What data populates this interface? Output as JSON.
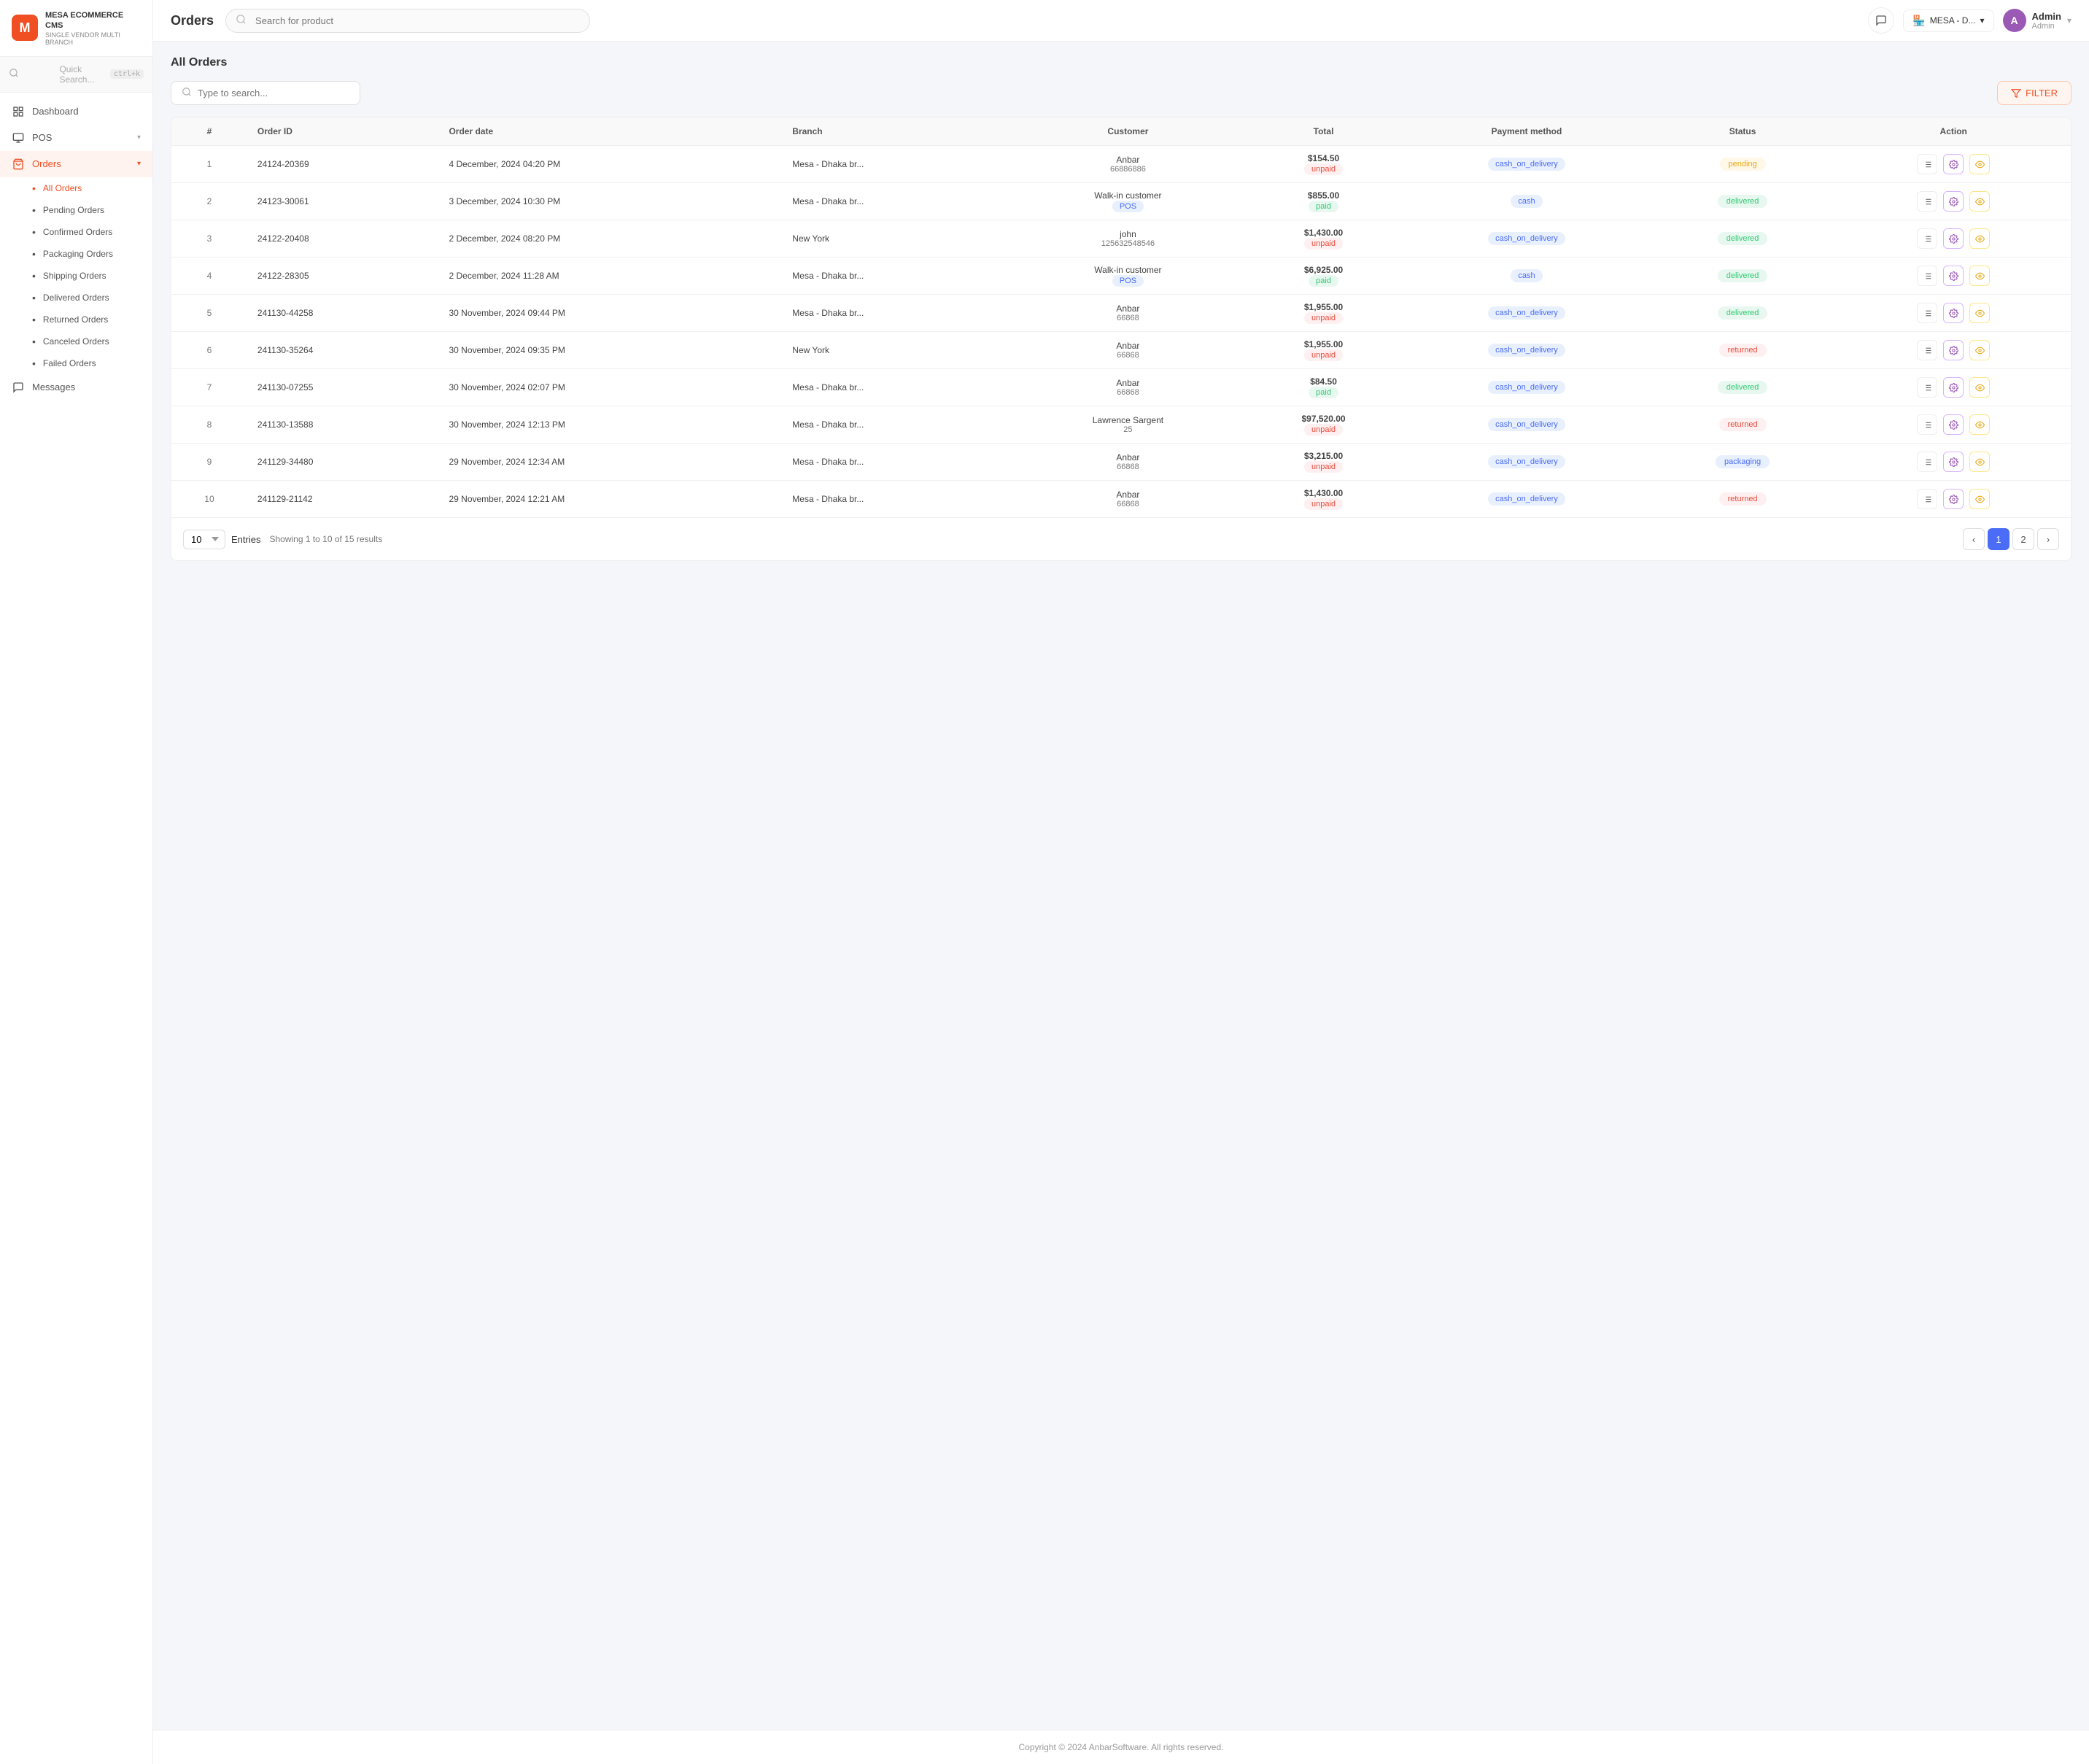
{
  "app": {
    "name": "MESA ECOMMERCE CMS",
    "tagline": "SINGLE VENDOR MULTI BRANCH"
  },
  "sidebar": {
    "search_placeholder": "Quick Search...",
    "search_shortcut": "ctrl+k",
    "nav_items": [
      {
        "id": "dashboard",
        "label": "Dashboard",
        "icon": "dashboard"
      },
      {
        "id": "pos",
        "label": "POS",
        "icon": "pos",
        "has_children": true
      },
      {
        "id": "orders",
        "label": "Orders",
        "icon": "orders",
        "active": true,
        "has_children": true
      }
    ],
    "orders_sub_items": [
      {
        "id": "all-orders",
        "label": "All Orders",
        "active": true
      },
      {
        "id": "pending-orders",
        "label": "Pending Orders"
      },
      {
        "id": "confirmed-orders",
        "label": "Confirmed Orders"
      },
      {
        "id": "packaging-orders",
        "label": "Packaging Orders"
      },
      {
        "id": "shipping-orders",
        "label": "Shipping Orders"
      },
      {
        "id": "delivered-orders",
        "label": "Delivered Orders"
      },
      {
        "id": "returned-orders",
        "label": "Returned Orders"
      },
      {
        "id": "canceled-orders",
        "label": "Canceled Orders"
      },
      {
        "id": "failed-orders",
        "label": "Failed Orders"
      }
    ],
    "extra_items": [
      {
        "id": "messages",
        "label": "Messages",
        "icon": "messages"
      }
    ]
  },
  "topbar": {
    "page_title": "Orders",
    "search_placeholder": "Search for product",
    "branch_name": "MESA - D...",
    "user": {
      "name": "Admin",
      "role": "Admin",
      "avatar_letter": "A"
    }
  },
  "content": {
    "title": "All Orders",
    "filter_placeholder": "Type to search...",
    "filter_btn": "FILTER",
    "table": {
      "columns": [
        "#",
        "Order ID",
        "Order date",
        "Branch",
        "Customer",
        "Total",
        "Payment method",
        "Status",
        "Action"
      ],
      "rows": [
        {
          "num": 1,
          "order_id": "24124-20369",
          "order_date": "4 December, 2024 04:20 PM",
          "branch": "Mesa - Dhaka br...",
          "customer_name": "Anbar",
          "customer_id": "66886886",
          "total": "$154.50",
          "payment_status": "unpaid",
          "payment_method": "cash_on_delivery",
          "status": "pending"
        },
        {
          "num": 2,
          "order_id": "24123-30061",
          "order_date": "3 December, 2024 10:30 PM",
          "branch": "Mesa - Dhaka br...",
          "customer_name": "Walk-in customer",
          "customer_id": "POS",
          "total": "$855.00",
          "payment_status": "paid",
          "payment_method": "cash",
          "status": "delivered"
        },
        {
          "num": 3,
          "order_id": "24122-20408",
          "order_date": "2 December, 2024 08:20 PM",
          "branch": "New York",
          "customer_name": "john",
          "customer_id": "125632548546",
          "total": "$1,430.00",
          "payment_status": "unpaid",
          "payment_method": "cash_on_delivery",
          "status": "delivered"
        },
        {
          "num": 4,
          "order_id": "24122-28305",
          "order_date": "2 December, 2024 11:28 AM",
          "branch": "Mesa - Dhaka br...",
          "customer_name": "Walk-in customer",
          "customer_id": "POS",
          "total": "$6,925.00",
          "payment_status": "paid",
          "payment_method": "cash",
          "status": "delivered"
        },
        {
          "num": 5,
          "order_id": "241130-44258",
          "order_date": "30 November, 2024 09:44 PM",
          "branch": "Mesa - Dhaka br...",
          "customer_name": "Anbar",
          "customer_id": "66868",
          "total": "$1,955.00",
          "payment_status": "unpaid",
          "payment_method": "cash_on_delivery",
          "status": "delivered"
        },
        {
          "num": 6,
          "order_id": "241130-35264",
          "order_date": "30 November, 2024 09:35 PM",
          "branch": "New York",
          "customer_name": "Anbar",
          "customer_id": "66868",
          "total": "$1,955.00",
          "payment_status": "unpaid",
          "payment_method": "cash_on_delivery",
          "status": "returned"
        },
        {
          "num": 7,
          "order_id": "241130-07255",
          "order_date": "30 November, 2024 02:07 PM",
          "branch": "Mesa - Dhaka br...",
          "customer_name": "Anbar",
          "customer_id": "66868",
          "total": "$84.50",
          "payment_status": "paid",
          "payment_method": "cash_on_delivery",
          "status": "delivered"
        },
        {
          "num": 8,
          "order_id": "241130-13588",
          "order_date": "30 November, 2024 12:13 PM",
          "branch": "Mesa - Dhaka br...",
          "customer_name": "Lawrence Sargent",
          "customer_id": "25",
          "total": "$97,520.00",
          "payment_status": "unpaid",
          "payment_method": "cash_on_delivery",
          "status": "returned"
        },
        {
          "num": 9,
          "order_id": "241129-34480",
          "order_date": "29 November, 2024 12:34 AM",
          "branch": "Mesa - Dhaka br...",
          "customer_name": "Anbar",
          "customer_id": "66868",
          "total": "$3,215.00",
          "payment_status": "unpaid",
          "payment_method": "cash_on_delivery",
          "status": "packaging"
        },
        {
          "num": 10,
          "order_id": "241129-21142",
          "order_date": "29 November, 2024 12:21 AM",
          "branch": "Mesa - Dhaka br...",
          "customer_name": "Anbar",
          "customer_id": "66868",
          "total": "$1,430.00",
          "payment_status": "unpaid",
          "payment_method": "cash_on_delivery",
          "status": "returned"
        }
      ]
    },
    "pagination": {
      "entries_value": "10",
      "entries_label": "Entries",
      "showing_text": "Showing 1 to 10 of 15 results",
      "current_page": 1,
      "total_pages": 2
    }
  },
  "footer": {
    "text": "Copyright © 2024 AnbarSoftware. All rights reserved."
  }
}
